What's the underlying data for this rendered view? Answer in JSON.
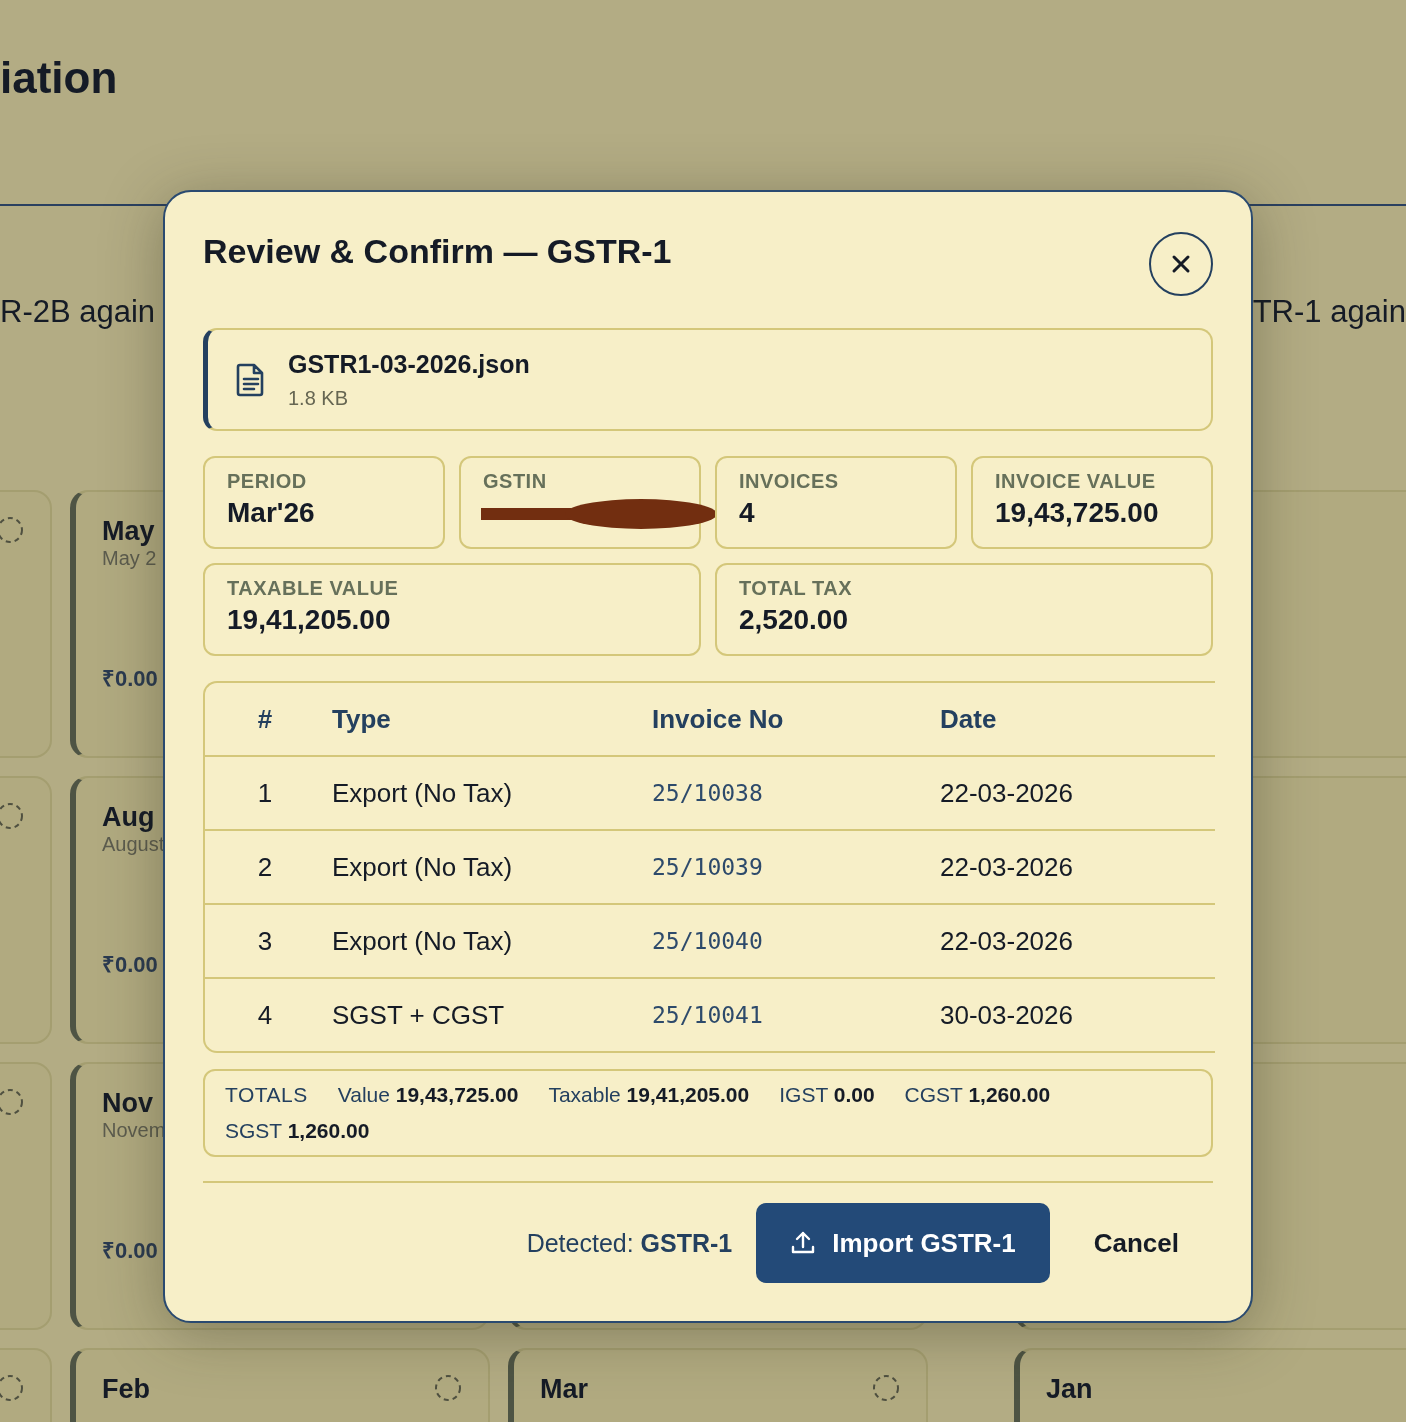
{
  "page": {
    "title": "iation",
    "panel_left_text": "R-2B again",
    "panel_right_text": "TR-1 again"
  },
  "background_cards": [
    {
      "month": "May",
      "subtitle": "May 2",
      "amount": "₹0.00",
      "status_icon": false
    },
    {
      "month": "Aug",
      "subtitle": "August",
      "amount": "₹0.00",
      "status_icon": false
    },
    {
      "month": "Nov",
      "subtitle": "Novem",
      "amount": "₹0.00",
      "status_icon": false
    },
    {
      "month": "Feb",
      "status_icon": true
    },
    {
      "month": "Mar",
      "status_icon": true
    },
    {
      "month": "Jan",
      "status_icon": false
    }
  ],
  "dialog": {
    "title": "Review & Confirm — GSTR-1",
    "file": {
      "name": "GSTR1-03-2026.json",
      "size": "1.8 KB"
    },
    "stats": [
      {
        "label": "PERIOD",
        "value": "Mar'26",
        "wide": false,
        "redacted": false
      },
      {
        "label": "GSTIN",
        "wide": false,
        "redacted": true
      },
      {
        "label": "INVOICES",
        "value": "4",
        "wide": false,
        "redacted": false
      },
      {
        "label": "INVOICE VALUE",
        "value": "19,43,725.00",
        "wide": false,
        "redacted": false
      },
      {
        "label": "TAXABLE VALUE",
        "value": "19,41,205.00",
        "wide": true,
        "redacted": false
      },
      {
        "label": "TOTAL TAX",
        "value": "2,520.00",
        "wide": true,
        "redacted": false
      }
    ],
    "table": {
      "columns": [
        "#",
        "Type",
        "Invoice No",
        "Date"
      ],
      "rows": [
        [
          "1",
          "Export (No Tax)",
          "25/10038",
          "22-03-2026"
        ],
        [
          "2",
          "Export (No Tax)",
          "25/10039",
          "22-03-2026"
        ],
        [
          "3",
          "Export (No Tax)",
          "25/10040",
          "22-03-2026"
        ],
        [
          "4",
          "SGST + CGST",
          "25/10041",
          "30-03-2026"
        ]
      ]
    },
    "totals": {
      "label": "TOTALS",
      "items": [
        {
          "label": "Value",
          "value": "19,43,725.00"
        },
        {
          "label": "Taxable",
          "value": "19,41,205.00"
        },
        {
          "label": "IGST",
          "value": "0.00"
        },
        {
          "label": "CGST",
          "value": "1,260.00"
        },
        {
          "label": "SGST",
          "value": "1,260.00"
        }
      ]
    },
    "footer": {
      "detected_label": "Detected:",
      "detected_value": "GSTR-1",
      "import_button": "Import GSTR-1",
      "cancel_button": "Cancel"
    }
  }
}
